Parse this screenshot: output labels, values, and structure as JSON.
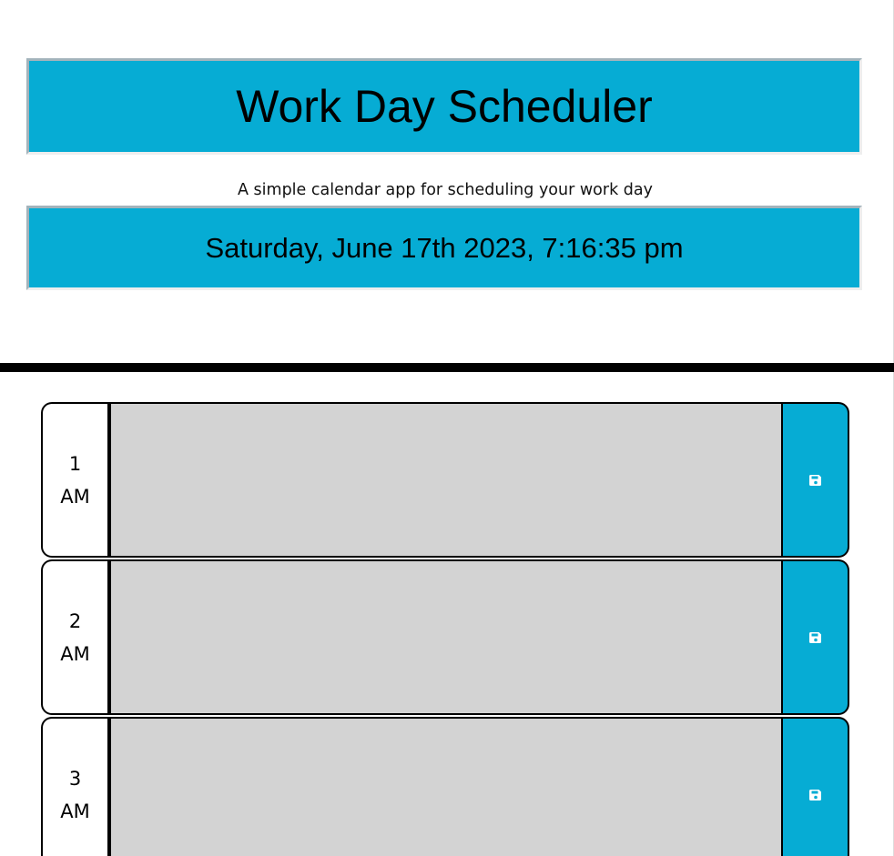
{
  "header": {
    "title": "Work Day Scheduler",
    "lead": "A simple calendar app for scheduling your work day",
    "current_day": "Saturday, June 17th 2023, 7:16:35 pm"
  },
  "time_blocks": [
    {
      "hour": "1",
      "period": "AM",
      "description": "",
      "save_icon": "save-icon"
    },
    {
      "hour": "2",
      "period": "AM",
      "description": "",
      "save_icon": "save-icon"
    },
    {
      "hour": "3",
      "period": "AM",
      "description": "",
      "save_icon": "save-icon"
    }
  ],
  "colors": {
    "accent": "#06acd4",
    "past_block": "#d3d3d3",
    "divider": "#000000"
  }
}
